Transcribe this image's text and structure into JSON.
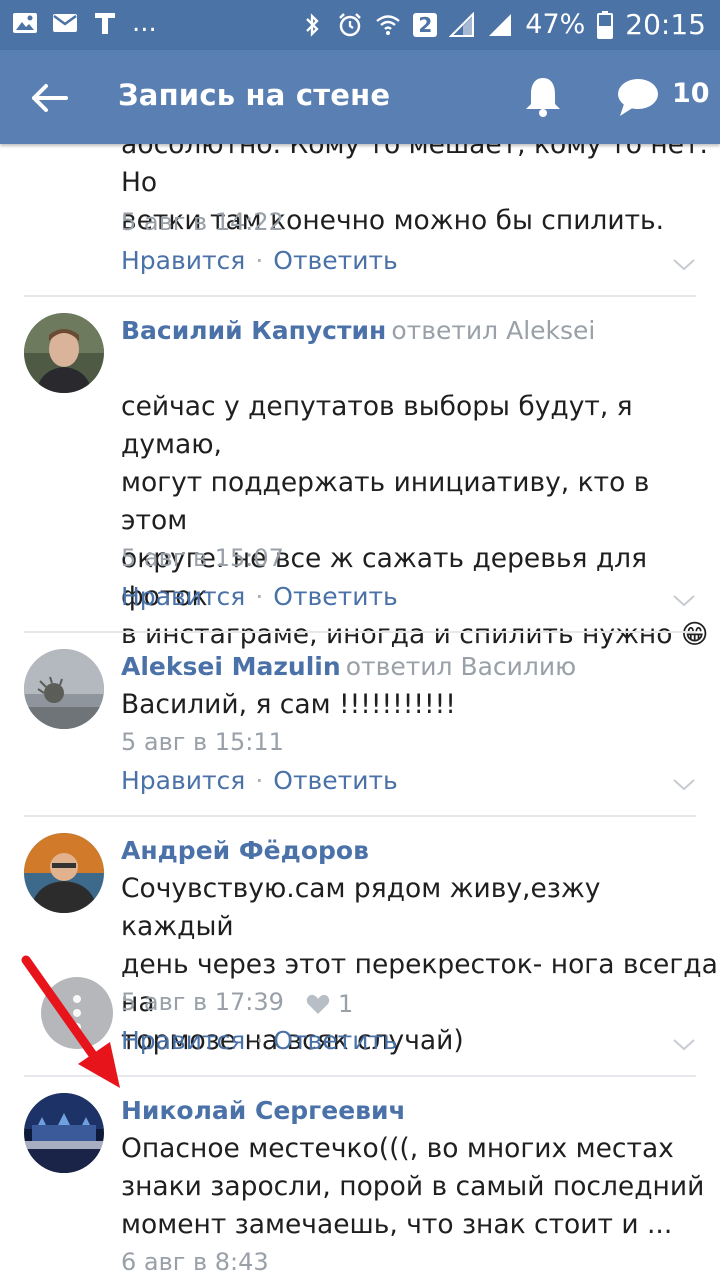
{
  "status_bar": {
    "left_icons": [
      "image-icon",
      "mail-icon",
      "t-icon"
    ],
    "ellipsis": "...",
    "sim_badge": "2",
    "battery": "47%",
    "time": "20:15"
  },
  "appbar": {
    "title": "Запись на стене",
    "message_count": "10"
  },
  "comments": [
    {
      "text_lines": [
        "абсолютно. Кому то мешает, кому то нет. Но",
        "ветки там конечно можно бы спилить."
      ],
      "date": "5 авг в 14:22",
      "like_label": "Нравится",
      "reply_label": "Ответить"
    },
    {
      "author": "Василий Капустин",
      "replied": "ответил Aleksei",
      "text_lines": [
        "сейчас у депутатов выборы будут, я думаю,",
        "могут поддержать инициативу, кто в этом",
        "округе. не все ж сажать деревья для фоток",
        "в инстаграме, иногда и спилить нужно"
      ],
      "emoji": "😁",
      "date": "5 авг в 15:07",
      "like_label": "Нравится",
      "reply_label": "Ответить"
    },
    {
      "author": "Aleksei Mazulin",
      "replied": "ответил Василию",
      "text_lines": [
        "Василий, я сам !!!!!!!!!!!"
      ],
      "date": "5 авг в 15:11",
      "like_label": "Нравится",
      "reply_label": "Ответить"
    },
    {
      "author": "Андрей Фёдоров",
      "text_lines": [
        "Сочувствую.сам рядом живу,езжу каждый",
        "день через этот перекресток- нога всегда на",
        "тормозе на всяк случай)"
      ],
      "date": "5 авг в 17:39",
      "likes": "1",
      "like_label": "Нравится",
      "reply_label": "Ответить"
    },
    {
      "author": "Николай Сергеевич",
      "text_lines": [
        "Опасное местечко(((, во многих местах",
        "знаки заросли, порой в самый последний",
        "момент замечаешь, что знак стоит и ..."
      ],
      "date": "6 авг в 8:43"
    }
  ],
  "colors": {
    "status_bar": "#4b73a6",
    "app_bar": "#5a80b3",
    "link": "#4a72a8",
    "annotation_arrow": "#e8141c"
  }
}
